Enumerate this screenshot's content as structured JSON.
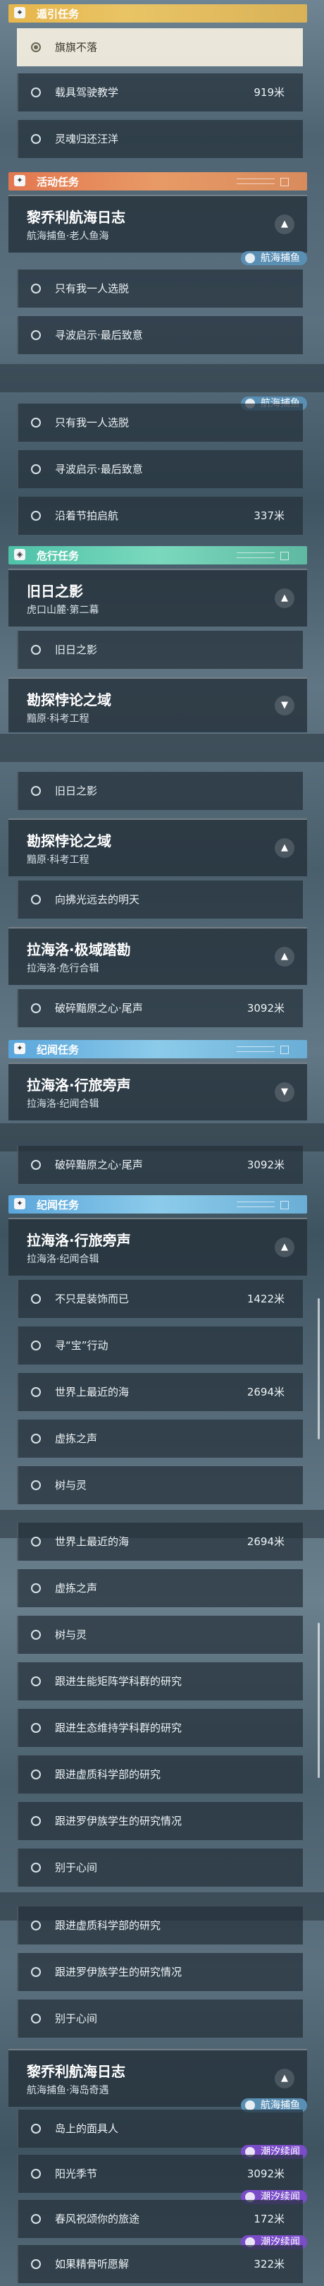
{
  "guide": {
    "title": "遁引任务",
    "rows": [
      {
        "label": "旗旗不落",
        "dist": ""
      },
      {
        "label": "载具驾驶教学",
        "dist": "919米"
      },
      {
        "label": "灵魂归还汪洋",
        "dist": ""
      }
    ]
  },
  "event": {
    "title": "活动任务"
  },
  "card_lqli": {
    "title": "黎乔利航海日志",
    "subtitle": "航海捕鱼·老人鱼海"
  },
  "badge_fish": "航海捕鱼",
  "event_rows": [
    {
      "label": "只有我一人选脱",
      "dist": ""
    },
    {
      "label": "寻波启示·最后致意",
      "dist": ""
    }
  ],
  "seg2_rows": [
    {
      "label": "只有我一人选脱",
      "dist": ""
    },
    {
      "label": "寻波启示·最后致意",
      "dist": ""
    },
    {
      "label": "沿着节拍启航",
      "dist": "337米"
    }
  ],
  "danger": {
    "title": "危行任务"
  },
  "card_jiuri": {
    "title": "旧日之影",
    "subtitle": "虎口山麓·第二幕"
  },
  "jiuri_row": {
    "label": "旧日之影",
    "dist": ""
  },
  "card_kantan": {
    "title": "勘探悖论之域",
    "subtitle": "黯原·科考工程"
  },
  "seg3_row": {
    "label": "旧日之影",
    "dist": ""
  },
  "card_kantan2": {
    "title": "勘探悖论之域",
    "subtitle": "黯原·科考工程"
  },
  "kantan_row": {
    "label": "向拂光远去的明天",
    "dist": ""
  },
  "card_lahai": {
    "title": "拉海洛·极域踏勘",
    "subtitle": "拉海洛·危行合辑"
  },
  "lahai_row": {
    "label": "破碎黯原之心·尾声",
    "dist": "3092米"
  },
  "ji": {
    "title": "纪闻任务"
  },
  "card_lahai2": {
    "title": "拉海洛·行旅旁声",
    "subtitle": "拉海洛·纪闻合辑"
  },
  "ji_row": {
    "label": "破碎黯原之心·尾声",
    "dist": "3092米"
  },
  "card_lahai3": {
    "title": "拉海洛·行旅旁声",
    "subtitle": "拉海洛·纪闻合辑"
  },
  "ji2_rows": [
    {
      "label": "不只是装饰而已",
      "dist": "1422米"
    },
    {
      "label": "寻“宝”行动",
      "dist": ""
    },
    {
      "label": "世界上最近的海",
      "dist": "2694米"
    },
    {
      "label": "虚拣之声",
      "dist": ""
    },
    {
      "label": "树与灵",
      "dist": ""
    }
  ],
  "seg5_rows": [
    {
      "label": "世界上最近的海",
      "dist": "2694米"
    },
    {
      "label": "虚拣之声",
      "dist": ""
    },
    {
      "label": "树与灵",
      "dist": ""
    },
    {
      "label": "跟进生能矩阵学科群的研究",
      "dist": ""
    },
    {
      "label": "跟进生态维持学科群的研究",
      "dist": ""
    },
    {
      "label": "跟进虚质科学部的研究",
      "dist": ""
    },
    {
      "label": "跟进罗伊族学生的研究情况",
      "dist": ""
    },
    {
      "label": "别于心间",
      "dist": ""
    }
  ],
  "seg6_rows": [
    {
      "label": "跟进虚质科学部的研究",
      "dist": ""
    },
    {
      "label": "跟进罗伊族学生的研究情况",
      "dist": ""
    },
    {
      "label": "别于心间",
      "dist": ""
    }
  ],
  "card_lqli2": {
    "title": "黎乔利航海日志",
    "subtitle": "航海捕鱼·海岛奇遇"
  },
  "badge_tide": "潮汐续闻",
  "final_rows": [
    {
      "label": "岛上的面具人",
      "dist": ""
    },
    {
      "label": "阳光季节",
      "dist": "3092米"
    },
    {
      "label": "春风祝颂你的旅途",
      "dist": "172米"
    },
    {
      "label": "如果精骨听愿解",
      "dist": "322米"
    }
  ]
}
